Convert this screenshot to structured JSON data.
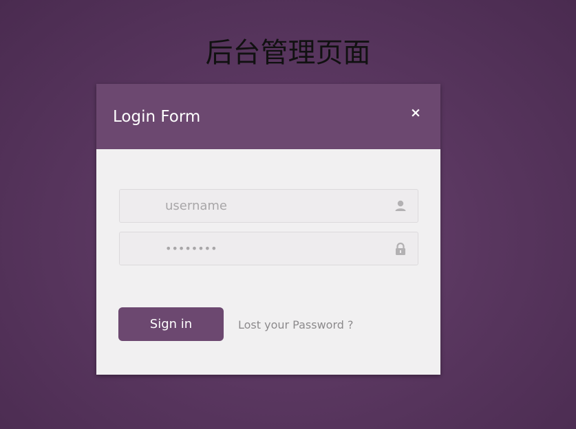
{
  "page": {
    "title": "后台管理页面"
  },
  "modal": {
    "title": "Login Form",
    "close_label": "×",
    "username": {
      "value": "",
      "placeholder": "username",
      "icon": "user-icon"
    },
    "password": {
      "value": "",
      "placeholder": "••••••••",
      "icon": "lock-icon"
    },
    "signin_label": "Sign in",
    "lost_password_label": "Lost your Password ?"
  },
  "colors": {
    "accent": "#6c4870",
    "background": "#5a3760",
    "panel": "#f1f0f1"
  }
}
